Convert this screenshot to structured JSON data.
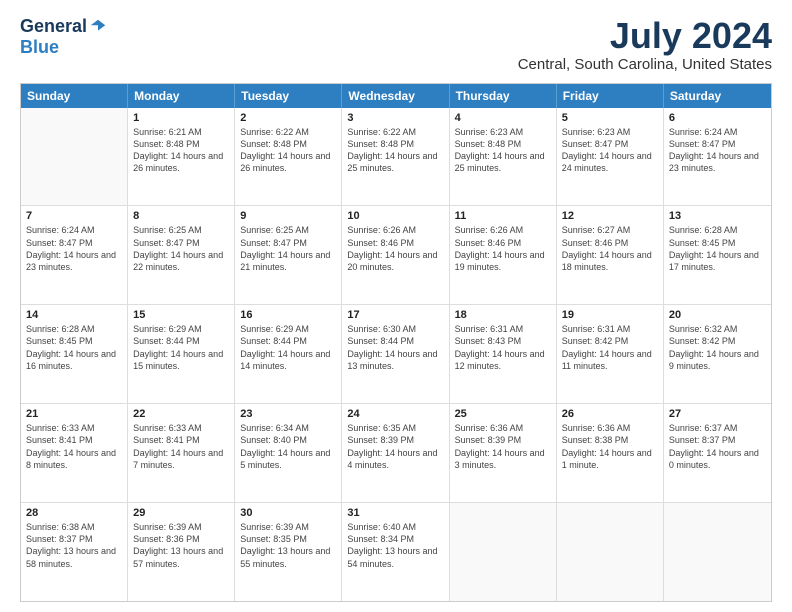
{
  "header": {
    "logo_general": "General",
    "logo_blue": "Blue",
    "month_title": "July 2024",
    "location": "Central, South Carolina, United States"
  },
  "days_of_week": [
    "Sunday",
    "Monday",
    "Tuesday",
    "Wednesday",
    "Thursday",
    "Friday",
    "Saturday"
  ],
  "weeks": [
    [
      {
        "day": "",
        "empty": true
      },
      {
        "day": "1",
        "sunrise": "Sunrise: 6:21 AM",
        "sunset": "Sunset: 8:48 PM",
        "daylight": "Daylight: 14 hours and 26 minutes."
      },
      {
        "day": "2",
        "sunrise": "Sunrise: 6:22 AM",
        "sunset": "Sunset: 8:48 PM",
        "daylight": "Daylight: 14 hours and 26 minutes."
      },
      {
        "day": "3",
        "sunrise": "Sunrise: 6:22 AM",
        "sunset": "Sunset: 8:48 PM",
        "daylight": "Daylight: 14 hours and 25 minutes."
      },
      {
        "day": "4",
        "sunrise": "Sunrise: 6:23 AM",
        "sunset": "Sunset: 8:48 PM",
        "daylight": "Daylight: 14 hours and 25 minutes."
      },
      {
        "day": "5",
        "sunrise": "Sunrise: 6:23 AM",
        "sunset": "Sunset: 8:47 PM",
        "daylight": "Daylight: 14 hours and 24 minutes."
      },
      {
        "day": "6",
        "sunrise": "Sunrise: 6:24 AM",
        "sunset": "Sunset: 8:47 PM",
        "daylight": "Daylight: 14 hours and 23 minutes."
      }
    ],
    [
      {
        "day": "7",
        "sunrise": "Sunrise: 6:24 AM",
        "sunset": "Sunset: 8:47 PM",
        "daylight": "Daylight: 14 hours and 23 minutes."
      },
      {
        "day": "8",
        "sunrise": "Sunrise: 6:25 AM",
        "sunset": "Sunset: 8:47 PM",
        "daylight": "Daylight: 14 hours and 22 minutes."
      },
      {
        "day": "9",
        "sunrise": "Sunrise: 6:25 AM",
        "sunset": "Sunset: 8:47 PM",
        "daylight": "Daylight: 14 hours and 21 minutes."
      },
      {
        "day": "10",
        "sunrise": "Sunrise: 6:26 AM",
        "sunset": "Sunset: 8:46 PM",
        "daylight": "Daylight: 14 hours and 20 minutes."
      },
      {
        "day": "11",
        "sunrise": "Sunrise: 6:26 AM",
        "sunset": "Sunset: 8:46 PM",
        "daylight": "Daylight: 14 hours and 19 minutes."
      },
      {
        "day": "12",
        "sunrise": "Sunrise: 6:27 AM",
        "sunset": "Sunset: 8:46 PM",
        "daylight": "Daylight: 14 hours and 18 minutes."
      },
      {
        "day": "13",
        "sunrise": "Sunrise: 6:28 AM",
        "sunset": "Sunset: 8:45 PM",
        "daylight": "Daylight: 14 hours and 17 minutes."
      }
    ],
    [
      {
        "day": "14",
        "sunrise": "Sunrise: 6:28 AM",
        "sunset": "Sunset: 8:45 PM",
        "daylight": "Daylight: 14 hours and 16 minutes."
      },
      {
        "day": "15",
        "sunrise": "Sunrise: 6:29 AM",
        "sunset": "Sunset: 8:44 PM",
        "daylight": "Daylight: 14 hours and 15 minutes."
      },
      {
        "day": "16",
        "sunrise": "Sunrise: 6:29 AM",
        "sunset": "Sunset: 8:44 PM",
        "daylight": "Daylight: 14 hours and 14 minutes."
      },
      {
        "day": "17",
        "sunrise": "Sunrise: 6:30 AM",
        "sunset": "Sunset: 8:44 PM",
        "daylight": "Daylight: 14 hours and 13 minutes."
      },
      {
        "day": "18",
        "sunrise": "Sunrise: 6:31 AM",
        "sunset": "Sunset: 8:43 PM",
        "daylight": "Daylight: 14 hours and 12 minutes."
      },
      {
        "day": "19",
        "sunrise": "Sunrise: 6:31 AM",
        "sunset": "Sunset: 8:42 PM",
        "daylight": "Daylight: 14 hours and 11 minutes."
      },
      {
        "day": "20",
        "sunrise": "Sunrise: 6:32 AM",
        "sunset": "Sunset: 8:42 PM",
        "daylight": "Daylight: 14 hours and 9 minutes."
      }
    ],
    [
      {
        "day": "21",
        "sunrise": "Sunrise: 6:33 AM",
        "sunset": "Sunset: 8:41 PM",
        "daylight": "Daylight: 14 hours and 8 minutes."
      },
      {
        "day": "22",
        "sunrise": "Sunrise: 6:33 AM",
        "sunset": "Sunset: 8:41 PM",
        "daylight": "Daylight: 14 hours and 7 minutes."
      },
      {
        "day": "23",
        "sunrise": "Sunrise: 6:34 AM",
        "sunset": "Sunset: 8:40 PM",
        "daylight": "Daylight: 14 hours and 5 minutes."
      },
      {
        "day": "24",
        "sunrise": "Sunrise: 6:35 AM",
        "sunset": "Sunset: 8:39 PM",
        "daylight": "Daylight: 14 hours and 4 minutes."
      },
      {
        "day": "25",
        "sunrise": "Sunrise: 6:36 AM",
        "sunset": "Sunset: 8:39 PM",
        "daylight": "Daylight: 14 hours and 3 minutes."
      },
      {
        "day": "26",
        "sunrise": "Sunrise: 6:36 AM",
        "sunset": "Sunset: 8:38 PM",
        "daylight": "Daylight: 14 hours and 1 minute."
      },
      {
        "day": "27",
        "sunrise": "Sunrise: 6:37 AM",
        "sunset": "Sunset: 8:37 PM",
        "daylight": "Daylight: 14 hours and 0 minutes."
      }
    ],
    [
      {
        "day": "28",
        "sunrise": "Sunrise: 6:38 AM",
        "sunset": "Sunset: 8:37 PM",
        "daylight": "Daylight: 13 hours and 58 minutes."
      },
      {
        "day": "29",
        "sunrise": "Sunrise: 6:39 AM",
        "sunset": "Sunset: 8:36 PM",
        "daylight": "Daylight: 13 hours and 57 minutes."
      },
      {
        "day": "30",
        "sunrise": "Sunrise: 6:39 AM",
        "sunset": "Sunset: 8:35 PM",
        "daylight": "Daylight: 13 hours and 55 minutes."
      },
      {
        "day": "31",
        "sunrise": "Sunrise: 6:40 AM",
        "sunset": "Sunset: 8:34 PM",
        "daylight": "Daylight: 13 hours and 54 minutes."
      },
      {
        "day": "",
        "empty": true
      },
      {
        "day": "",
        "empty": true
      },
      {
        "day": "",
        "empty": true
      }
    ]
  ]
}
